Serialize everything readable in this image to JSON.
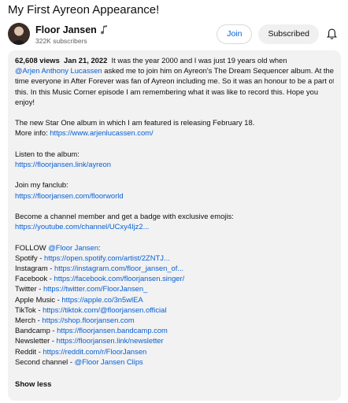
{
  "video": {
    "title": "My First Ayreon Appearance!"
  },
  "channel": {
    "name": "Floor Jansen",
    "subscribers": "322K subscribers",
    "verified_icon": "music-note-icon"
  },
  "buttons": {
    "join": "Join",
    "subscribed": "Subscribed",
    "bell_icon": "bell-icon"
  },
  "description": {
    "views": "62,608 views",
    "date": "Jan 21, 2022",
    "p1_a": "It was the year 2000 and I was just 19 years old when",
    "p1_link": "@Arjen Anthony Lucassen",
    "p1_b": " asked me to join him on Ayreon's The Dream Sequencer album. At the",
    "p1_c": "time everyone in After Forever was fan of Ayreon including me. So it was an honour to be a part of",
    "p1_d": "this. In this Music Corner episode I am remembering what it was like to record this. Hope you",
    "p1_e": "enjoy!",
    "p2_a": "The new Star One album in which I am featured is releasing February 18.",
    "p2_b": "More info: ",
    "p2_link": "https://www.arjenlucassen.com/",
    "p3_a": "Listen to the album:",
    "p3_link": "https://floorjansen.link/ayreon",
    "p4_a": "Join my fanclub:",
    "p4_link": "https://floorjansen.com/floorworld",
    "p5_a": "Become a channel member and get a badge with exclusive emojis:",
    "p5_link": "https://youtube.com/channel/UCxy4Ijz2...",
    "follow_prefix": "FOLLOW ",
    "follow_link": "@Floor Jansen",
    "follow_suffix": ":",
    "socials": [
      {
        "label": "Spotify - ",
        "link": "https://open.spotify.com/artist/2ZNTJ..."
      },
      {
        "label": "Instagram - ",
        "link": "https://instagram.com/floor_jansen_of..."
      },
      {
        "label": "Facebook - ",
        "link": "https://facebook.com/floorjansen.singer/"
      },
      {
        "label": "Twitter - ",
        "link": "https://twitter.com/FloorJansen_"
      },
      {
        "label": "Apple Music - ",
        "link": "https://apple.co/3n5wlEA"
      },
      {
        "label": "TikTok - ",
        "link": "https://tiktok.com/@floorjansen.official"
      },
      {
        "label": "Merch - ",
        "link": "https://shop.floorjansen.com"
      },
      {
        "label": "Bandcamp - ",
        "link": "https://floorjansen.bandcamp.com"
      },
      {
        "label": "Newsletter - ",
        "link": "https://floorjansen.link/newsletter"
      },
      {
        "label": "Reddit - ",
        "link": "https://reddit.com/r/FloorJansen"
      },
      {
        "label": "Second channel - ",
        "link": "@Floor Jansen Clips"
      }
    ],
    "show_less": "Show less"
  },
  "colors": {
    "link": "#065fd4",
    "description_bg": "#f2f2f2",
    "button_bg": "#f0f0f0"
  }
}
